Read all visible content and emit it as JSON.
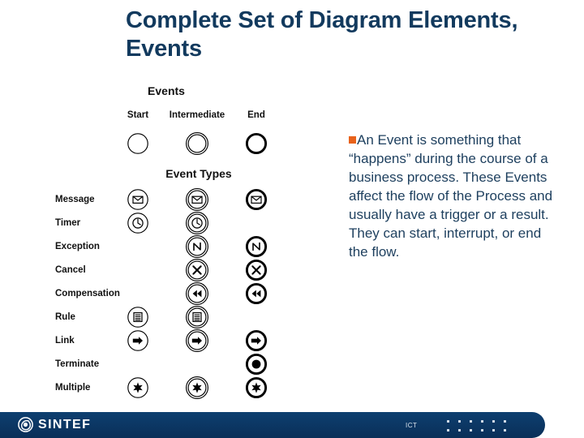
{
  "slide": {
    "title": "Complete Set of Diagram Elements, Events"
  },
  "diagram": {
    "events_heading": "Events",
    "event_types_heading": "Event Types",
    "columns": [
      {
        "label": "Start",
        "key": "start"
      },
      {
        "label": "Intermediate",
        "key": "intermediate"
      },
      {
        "label": "End",
        "key": "end"
      }
    ],
    "top_row": {
      "start": "circle-thin",
      "intermediate": "circle-double",
      "end": "circle-thick"
    },
    "rows": [
      {
        "label": "Message",
        "start": "envelope-icon",
        "intermediate": "envelope-icon",
        "end": "envelope-icon"
      },
      {
        "label": "Timer",
        "start": "clock-icon",
        "intermediate": "clock-icon",
        "end": null
      },
      {
        "label": "Exception",
        "start": null,
        "intermediate": "lightning-icon",
        "end": "lightning-icon"
      },
      {
        "label": "Cancel",
        "start": null,
        "intermediate": "x-icon",
        "end": "x-icon"
      },
      {
        "label": "Compensation",
        "start": null,
        "intermediate": "rewind-icon",
        "end": "rewind-icon"
      },
      {
        "label": "Rule",
        "start": "lined-page-icon",
        "intermediate": "lined-page-icon",
        "end": null
      },
      {
        "label": "Link",
        "start": "arrow-right-icon",
        "intermediate": "arrow-right-icon",
        "end": "arrow-right-icon"
      },
      {
        "label": "Terminate",
        "start": null,
        "intermediate": null,
        "end": "filled-dot-icon"
      },
      {
        "label": "Multiple",
        "start": "star-icon",
        "intermediate": "star-icon",
        "end": "star-icon"
      }
    ]
  },
  "body": {
    "bullet": "square-bullet",
    "text": "An Event is something that “happens” during the course of a business process. These Events affect the flow of the Process and usually have a trigger or a result. They can start, interrupt, or end the flow."
  },
  "footer": {
    "logo_text": "SINTEF",
    "logo_mark": "sintef-swirl-logo",
    "unit": "ICT"
  },
  "colors": {
    "title": "#123a5e",
    "body_text": "#1d3f5e",
    "bullet": "#e8621b",
    "footer_bar": "#0b3c6b",
    "diagram_ink": "#111111"
  }
}
